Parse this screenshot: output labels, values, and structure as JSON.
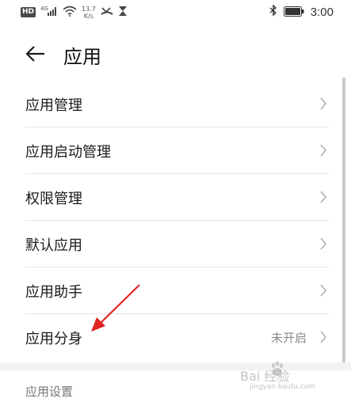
{
  "status_bar": {
    "hd_badge": "HD",
    "network_text": "4G",
    "speed_value": "13.7",
    "speed_unit": "K/s",
    "time": "3:00"
  },
  "header": {
    "title": "应用"
  },
  "list": {
    "items": [
      {
        "label": "应用管理",
        "value": ""
      },
      {
        "label": "应用启动管理",
        "value": ""
      },
      {
        "label": "权限管理",
        "value": ""
      },
      {
        "label": "默认应用",
        "value": ""
      },
      {
        "label": "应用助手",
        "value": ""
      },
      {
        "label": "应用分身",
        "value": "未开启"
      }
    ]
  },
  "section": {
    "header": "应用设置"
  },
  "watermark": {
    "main": "Bai 经验",
    "sub": "jingyan.baidu.com"
  },
  "colors": {
    "annotation_arrow": "#e02424",
    "chevron": "#b0b0b0",
    "divider": "#e6e6e6"
  }
}
